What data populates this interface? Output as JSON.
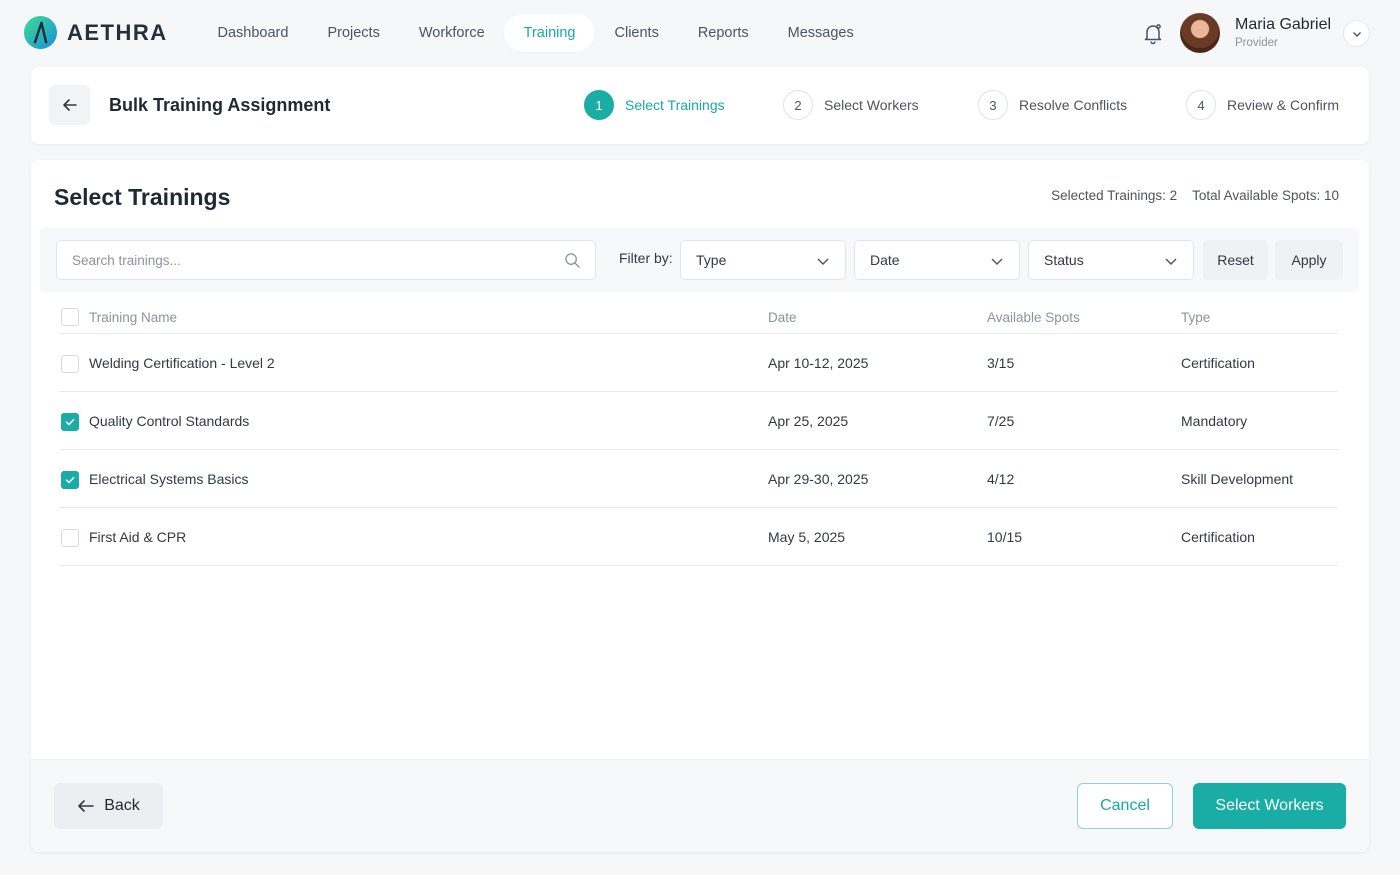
{
  "brand": {
    "name": "AETHRA",
    "accent": "#19ada5"
  },
  "nav": {
    "items": [
      {
        "label": "Dashboard",
        "active": false
      },
      {
        "label": "Projects",
        "active": false
      },
      {
        "label": "Workforce",
        "active": false
      },
      {
        "label": "Training",
        "active": true
      },
      {
        "label": "Clients",
        "active": false
      },
      {
        "label": "Reports",
        "active": false
      },
      {
        "label": "Messages",
        "active": false
      }
    ]
  },
  "user": {
    "name": "Maria Gabriel",
    "role": "Provider"
  },
  "header": {
    "title": "Bulk Training Assignment",
    "steps": [
      {
        "number": "1",
        "label": "Select Trainings",
        "active": true
      },
      {
        "number": "2",
        "label": "Select Workers",
        "active": false
      },
      {
        "number": "3",
        "label": "Resolve Conflicts",
        "active": false
      },
      {
        "number": "4",
        "label": "Review & Confirm",
        "active": false
      }
    ]
  },
  "main": {
    "title": "Select Trainings",
    "selected_summary": "Selected Trainings: 2",
    "spots_summary": "Total Available Spots: 10",
    "search": {
      "placeholder": "Search trainings...",
      "value": ""
    },
    "filter_label": "Filter by:",
    "filters": [
      {
        "value": "Type"
      },
      {
        "value": "Date"
      },
      {
        "value": "Status"
      }
    ],
    "reset_label": "Reset",
    "apply_label": "Apply",
    "table": {
      "columns": [
        "Training Name",
        "Date",
        "Available Spots",
        "Type"
      ],
      "rows": [
        {
          "name": "Welding Certification - Level 2",
          "date": "Apr 10-12, 2025",
          "spots": "3/15",
          "type": "Certification",
          "checked": false
        },
        {
          "name": "Quality Control Standards",
          "date": "Apr 25, 2025",
          "spots": "7/25",
          "type": "Mandatory",
          "checked": true
        },
        {
          "name": "Electrical Systems Basics",
          "date": "Apr 29-30, 2025",
          "spots": "4/12",
          "type": "Skill Development",
          "checked": true
        },
        {
          "name": "First Aid & CPR",
          "date": "May 5, 2025",
          "spots": "10/15",
          "type": "Certification",
          "checked": false
        }
      ]
    }
  },
  "footer": {
    "back_label": "Back",
    "cancel_label": "Cancel",
    "next_label": "Select Workers"
  }
}
